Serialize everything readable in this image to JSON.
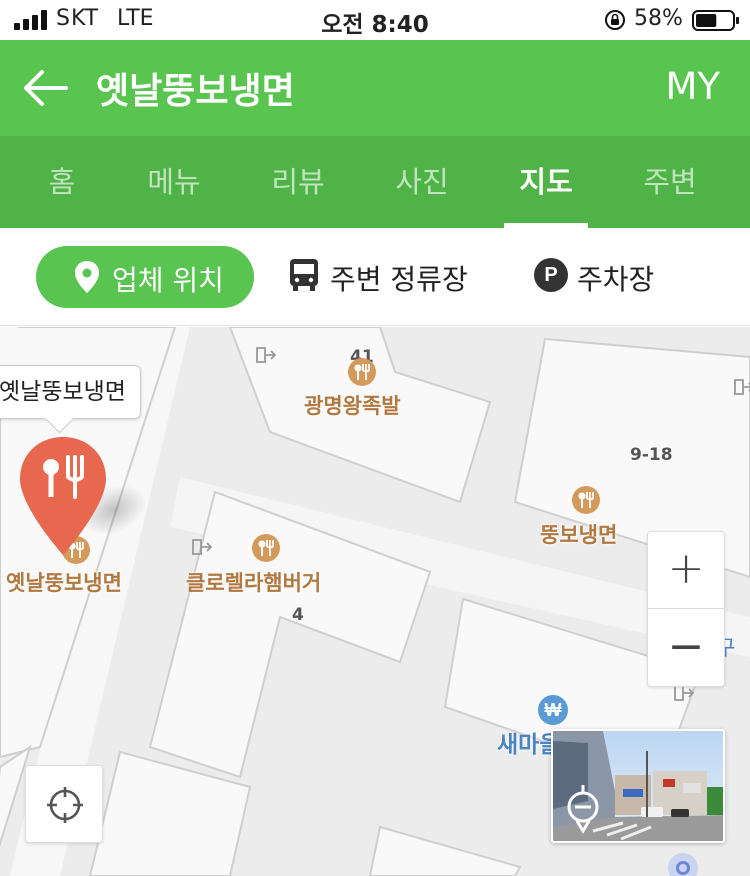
{
  "status_bar": {
    "carrier": "SKT",
    "network": "LTE",
    "time": "오전 8:40",
    "battery_percent": "58%",
    "battery_level": 0.58
  },
  "header": {
    "title": "옛날뚱보냉면",
    "my_label": "MY"
  },
  "tabs": [
    {
      "label": "홈",
      "active": false
    },
    {
      "label": "메뉴",
      "active": false
    },
    {
      "label": "리뷰",
      "active": false
    },
    {
      "label": "사진",
      "active": false
    },
    {
      "label": "지도",
      "active": true
    },
    {
      "label": "주변",
      "active": false
    }
  ],
  "subbar": {
    "location_button": "업체 위치",
    "bus_stop_button": "주변 정류장",
    "parking_icon_letter": "P",
    "parking_button": "주차장"
  },
  "map": {
    "callout": "옛날뚱보냉면",
    "pois": [
      {
        "name": "광명왕족발"
      },
      {
        "name": "뚱보냉면"
      },
      {
        "name": "클로렐라햄버거"
      },
      {
        "name": "옛날뚱보냉면"
      }
    ],
    "numbers": {
      "n1": "41",
      "n2": "9-18",
      "n3": "4"
    },
    "station_symbol": "₩",
    "station_label": "새마을",
    "right_edge_text": "구",
    "zoom_in": "+",
    "zoom_out": "−"
  },
  "colors": {
    "brand_green": "#5ac451",
    "tab_green": "#4fb347",
    "pin_red": "#e8674f",
    "poi_brown": "#b17840"
  }
}
